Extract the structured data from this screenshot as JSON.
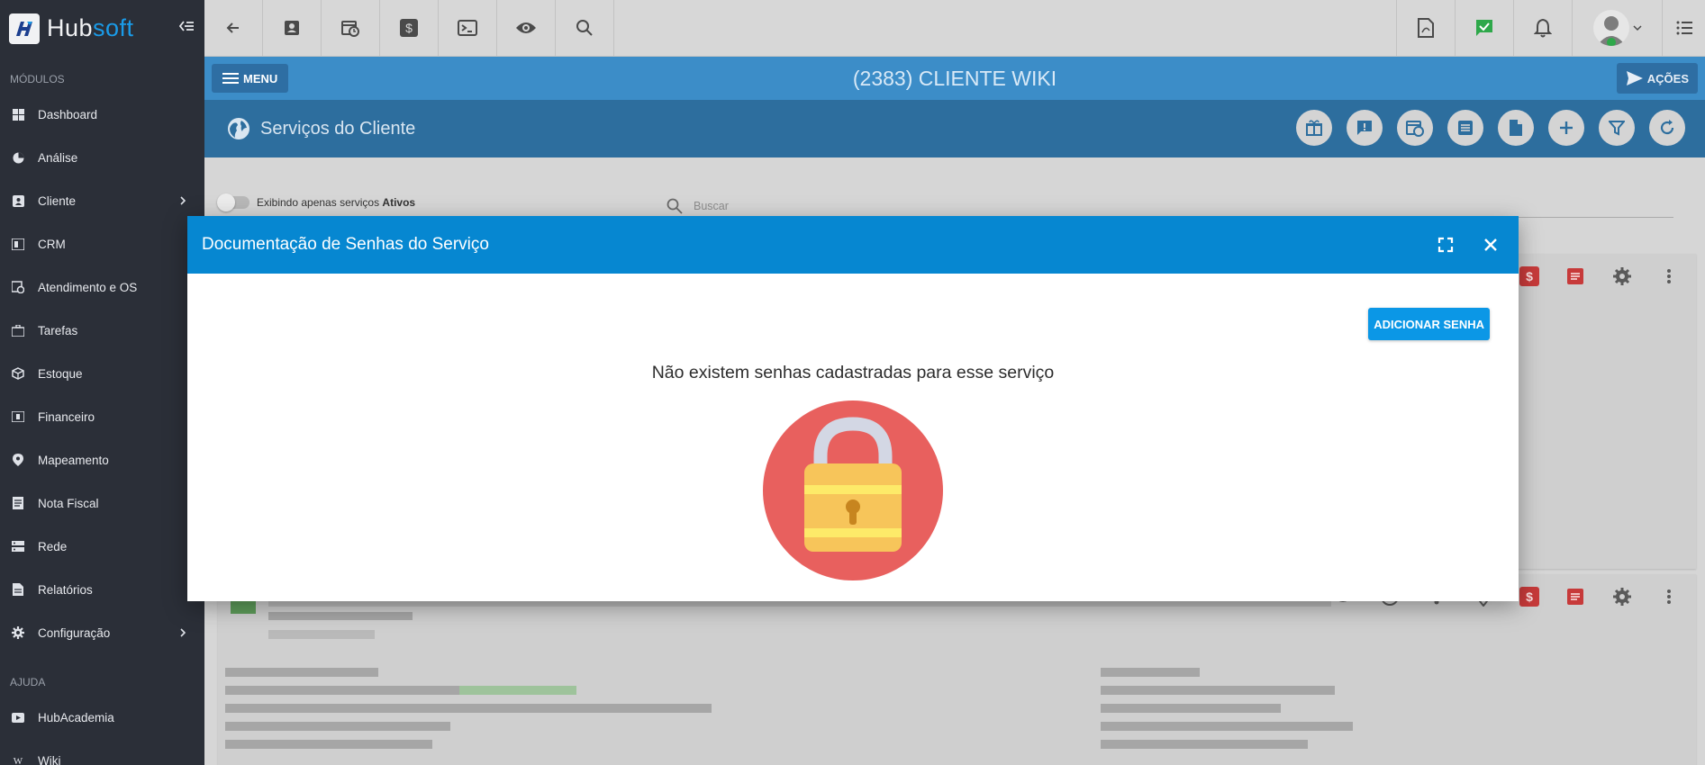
{
  "brand": {
    "hub": "Hub",
    "soft": "soft"
  },
  "sidebar": {
    "modules_title": "MÓDULOS",
    "items": [
      {
        "label": "Dashboard",
        "icon": "dashboard-icon"
      },
      {
        "label": "Análise",
        "icon": "pie-chart-icon"
      },
      {
        "label": "Cliente",
        "icon": "contact-icon",
        "has_submenu": true
      },
      {
        "label": "CRM",
        "icon": "crm-icon"
      },
      {
        "label": "Atendimento e OS",
        "icon": "calendar-clock-icon"
      },
      {
        "label": "Tarefas",
        "icon": "briefcase-icon"
      },
      {
        "label": "Estoque",
        "icon": "box-icon"
      },
      {
        "label": "Financeiro",
        "icon": "money-icon"
      },
      {
        "label": "Mapeamento",
        "icon": "map-pin-icon"
      },
      {
        "label": "Nota Fiscal",
        "icon": "receipt-icon"
      },
      {
        "label": "Rede",
        "icon": "network-icon"
      },
      {
        "label": "Relatórios",
        "icon": "report-icon"
      },
      {
        "label": "Configuração",
        "icon": "gear-icon",
        "has_submenu": true
      }
    ],
    "help_title": "AJUDA",
    "help_items": [
      {
        "label": "HubAcademia",
        "icon": "video-icon"
      },
      {
        "label": "Wiki",
        "icon": "wiki-icon"
      }
    ]
  },
  "client_bar": {
    "menu_label": "MENU",
    "title": "(2383) CLIENTE WIKI",
    "actions_label": "AÇÕES"
  },
  "services_bar": {
    "title": "Serviços do Cliente"
  },
  "filters": {
    "toggle_prefix": "Exibindo apenas serviços ",
    "toggle_bold": "Ativos",
    "search_placeholder": "Buscar"
  },
  "modal": {
    "title": "Documentação de Senhas do Serviço",
    "add_button": "ADICIONAR SENHA",
    "empty_message": "Não existem senhas cadastradas para esse serviço"
  },
  "colors": {
    "primary": "#0687d1",
    "add_button": "#0b97e6",
    "lock_circle": "#e8605e",
    "lock_body": "#f7c55a",
    "lock_stripe": "#fdea69",
    "sidebar": "#2b2f38"
  }
}
